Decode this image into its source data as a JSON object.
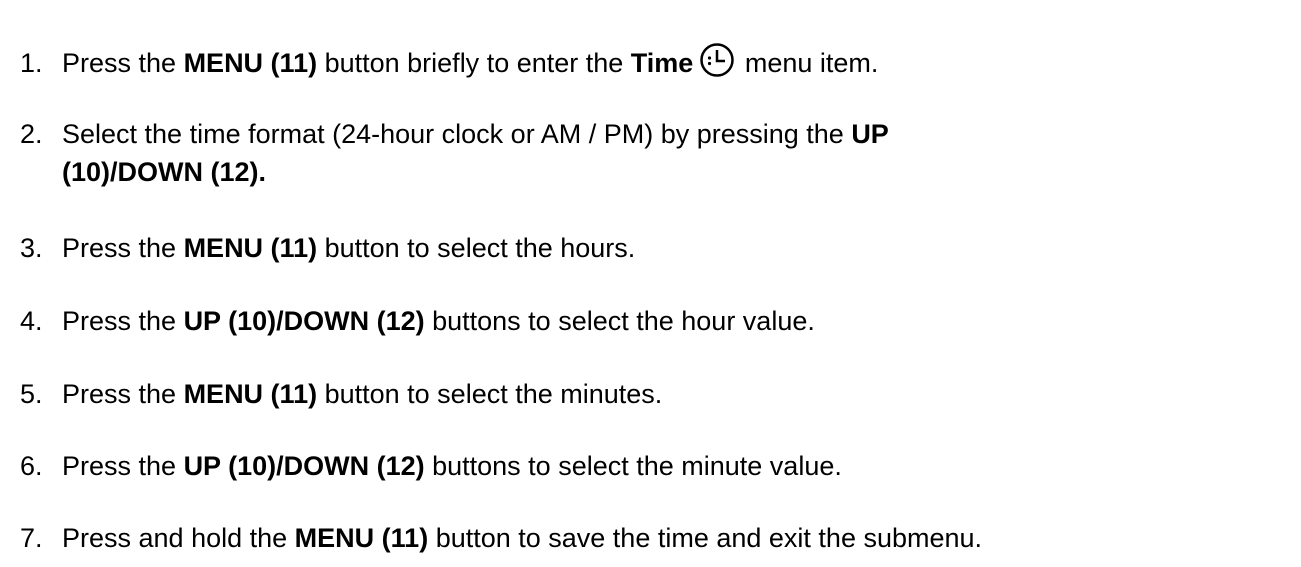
{
  "steps": [
    {
      "num": "1.",
      "a": "Press the ",
      "b1": "MENU (11)",
      "c": " button briefly to enter the ",
      "b2": "Time",
      "icon": "clock-icon",
      "d": " menu item."
    },
    {
      "num": "2.",
      "a": "Select the time format (24-hour clock or AM / PM) by pressing the ",
      "b1": "UP",
      "b2": "(10)/DOWN (12)."
    },
    {
      "num": "3.",
      "a": "Press the ",
      "b1": "MENU (11)",
      "c": " button to select the hours."
    },
    {
      "num": "4.",
      "a": "Press the ",
      "b1": "UP (10)/DOWN (12)",
      "c": " buttons to select the hour value."
    },
    {
      "num": "5.",
      "a": "Press the ",
      "b1": "MENU (11)",
      "c": " button to select the minutes."
    },
    {
      "num": "6.",
      "a": "Press the ",
      "b1": "UP (10)/DOWN (12)",
      "c": " buttons to select the minute value."
    },
    {
      "num": "7.",
      "a": "Press and hold the ",
      "b1": "MENU (11)",
      "c": " button to save the time and exit the submenu."
    }
  ]
}
